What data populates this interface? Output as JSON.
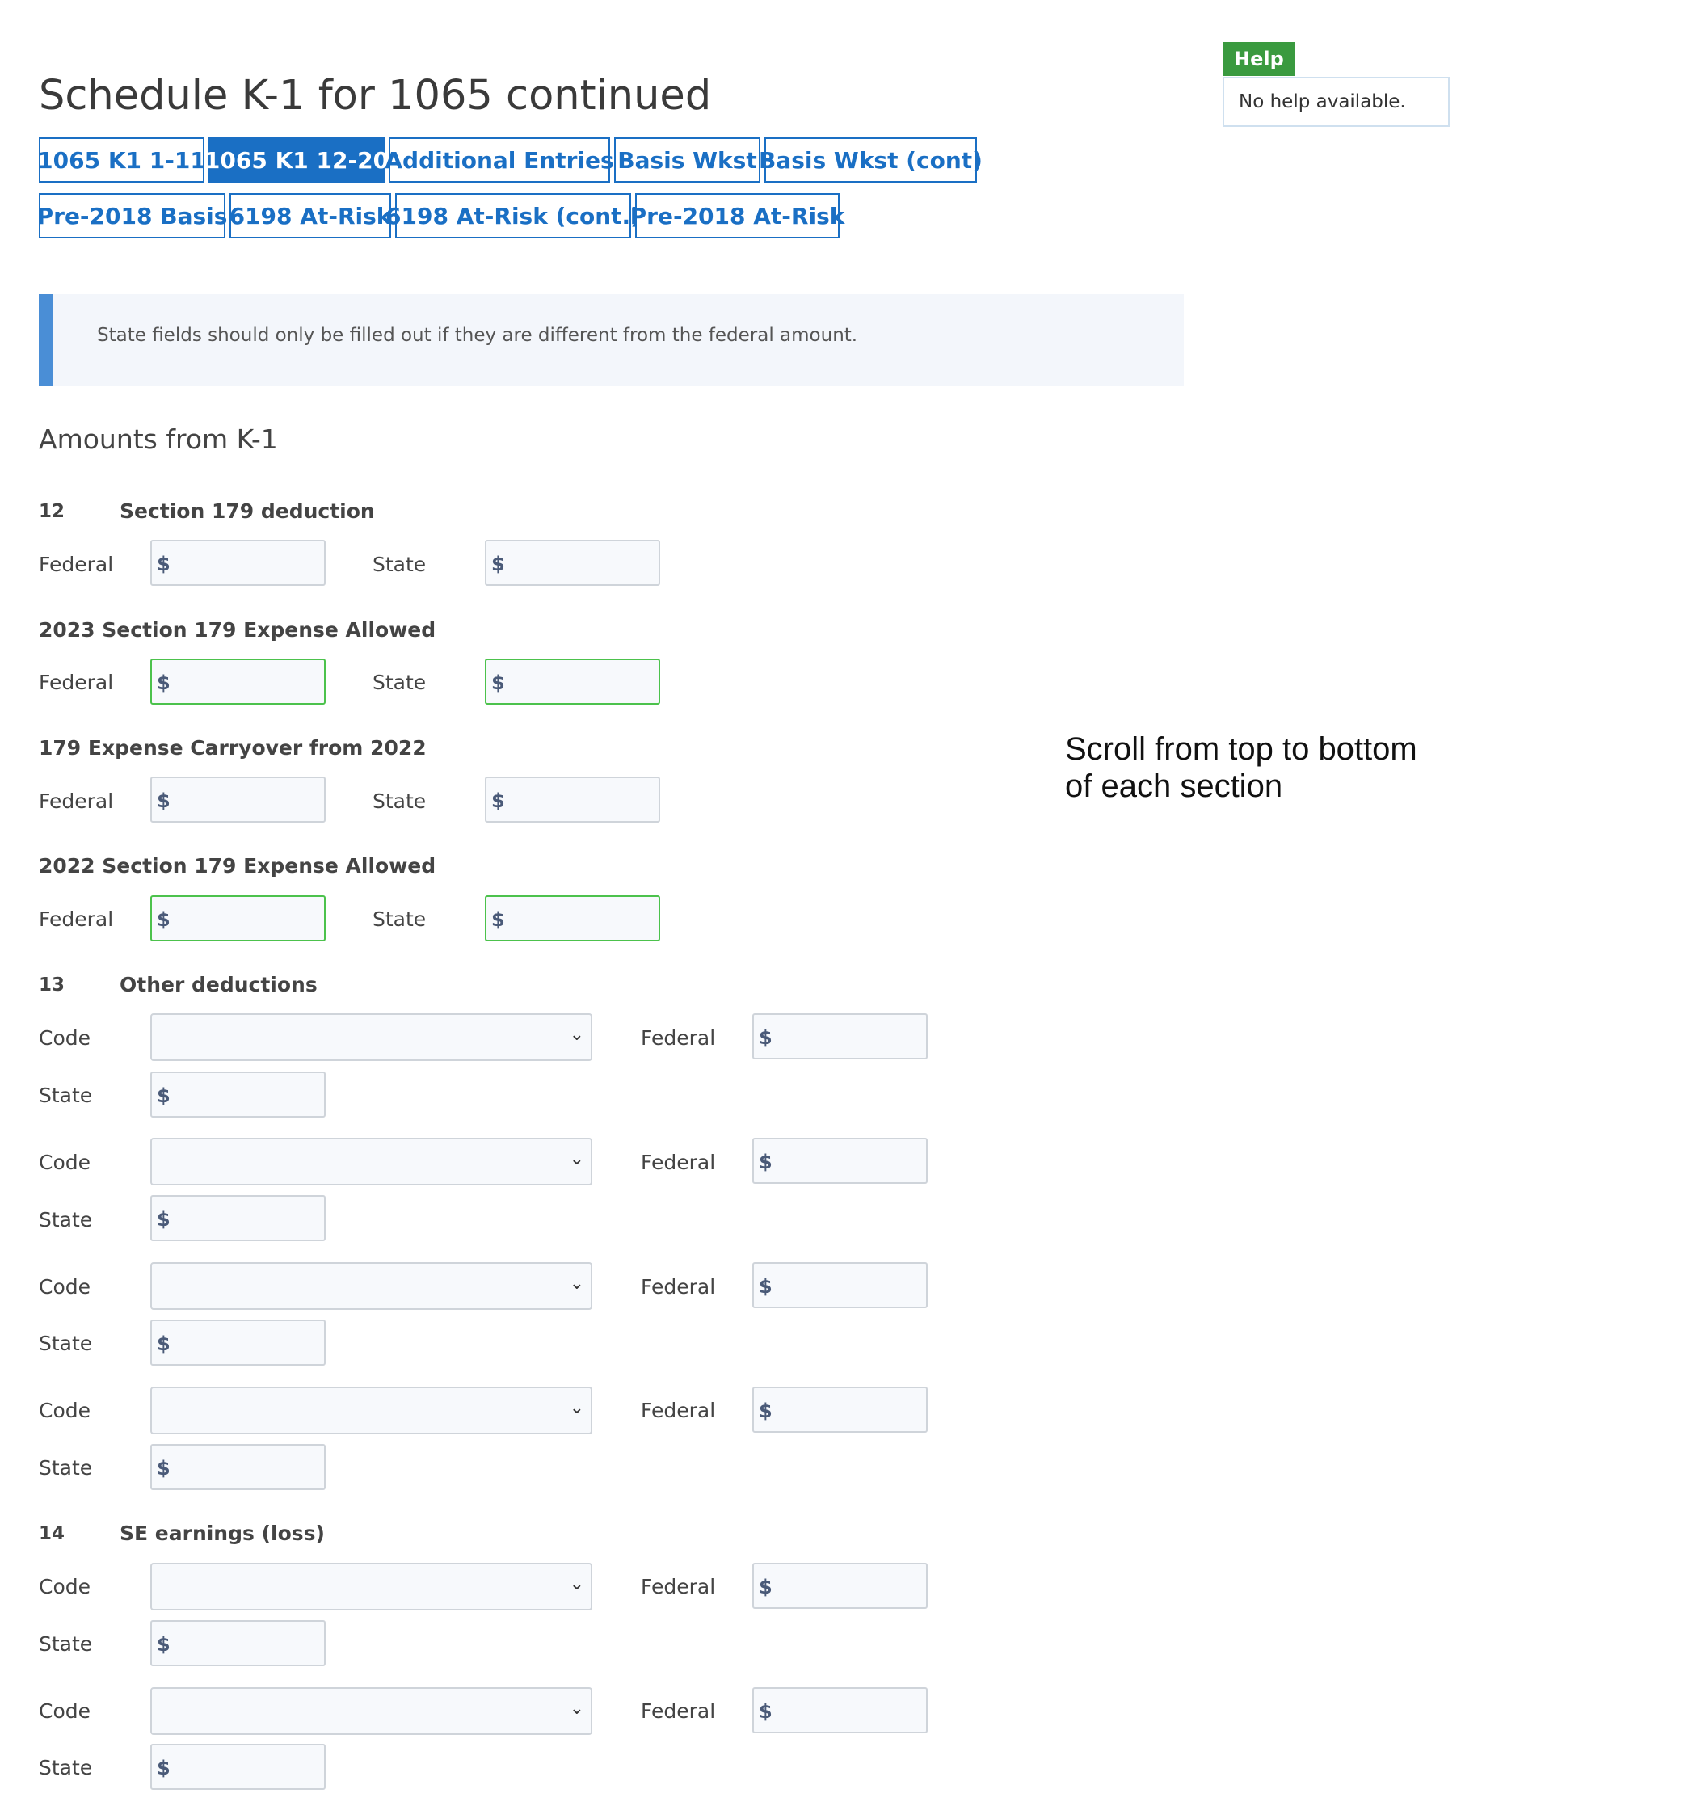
{
  "page": {
    "title": "Schedule K-1 for 1065 continued"
  },
  "tabs": [
    {
      "label": "1065 K1 1-11",
      "active": false
    },
    {
      "label": "1065 K1 12-20",
      "active": true
    },
    {
      "label": "Additional Entries",
      "active": false
    },
    {
      "label": "Basis Wkst",
      "active": false
    },
    {
      "label": "Basis Wkst (cont)",
      "active": false
    },
    {
      "label": "Pre-2018 Basis",
      "active": false
    },
    {
      "label": "6198 At-Risk",
      "active": false
    },
    {
      "label": "6198 At-Risk (cont.)",
      "active": false
    },
    {
      "label": "Pre-2018 At-Risk",
      "active": false
    }
  ],
  "notice": {
    "text": "State fields should only be filled out if they are different from the federal amount."
  },
  "section": {
    "heading": "Amounts from K-1"
  },
  "labels": {
    "federal": "Federal",
    "state": "State",
    "code": "Code",
    "currency": "$"
  },
  "line12": {
    "number": "12",
    "title": "Section 179 deduction",
    "sub1": "2023 Section 179 Expense Allowed",
    "sub2": "179 Expense Carryover from 2022",
    "sub3": "2022 Section 179 Expense Allowed"
  },
  "line13": {
    "number": "13",
    "title": "Other deductions"
  },
  "line14": {
    "number": "14",
    "title": "SE earnings (loss)"
  },
  "help": {
    "badge": "Help",
    "text": "No help available."
  },
  "annotation": {
    "line1": "Scroll from top to bottom",
    "line2": "of each section"
  },
  "colors": {
    "accent": "#1a6fc4",
    "help_green": "#3a9a3f",
    "valid_border": "#4cc24c",
    "notice_bar": "#4a8ed6"
  }
}
